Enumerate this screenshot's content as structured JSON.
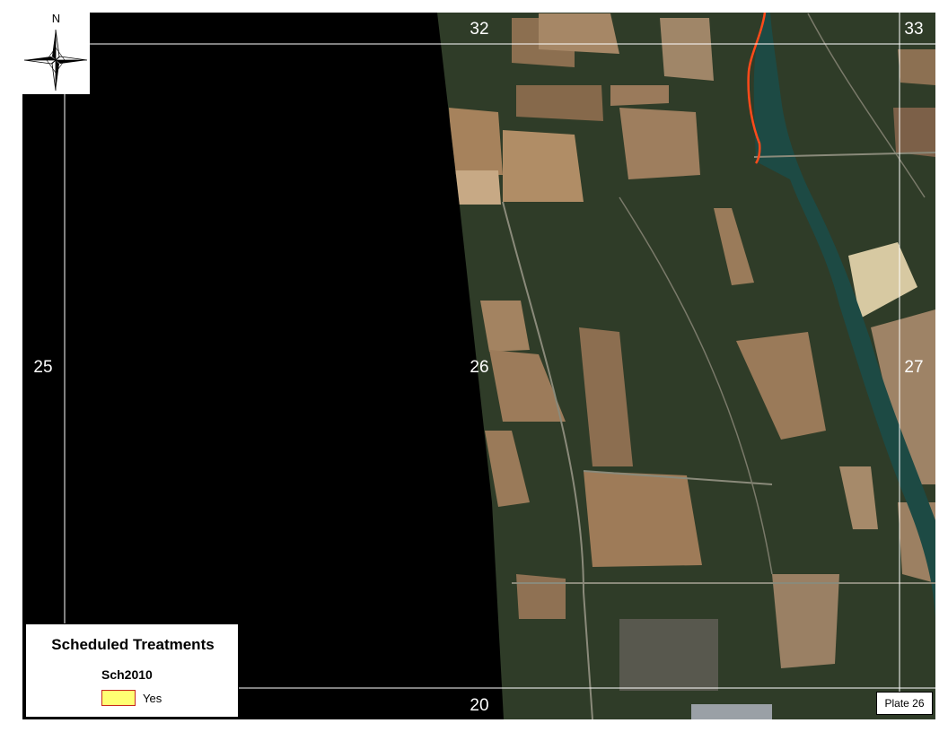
{
  "map": {
    "north_label": "N",
    "section_numbers": {
      "top_left": "32",
      "top_right": "33",
      "middle_left": "25",
      "middle_center": "26",
      "middle_right": "27",
      "bottom_center": "20"
    },
    "colors": {
      "no_data": "#000000",
      "forest": "#2c3a26",
      "field": "#9c7a55",
      "river": "#1d4a44",
      "treatment_outline": "#ff4a1a"
    }
  },
  "legend": {
    "title": "Scheduled Treatments",
    "field_name": "Sch2010",
    "item_label": "Yes",
    "item_fill": "#ffff73",
    "item_outline": "#c8281e"
  },
  "plate": {
    "label": "Plate 26"
  }
}
